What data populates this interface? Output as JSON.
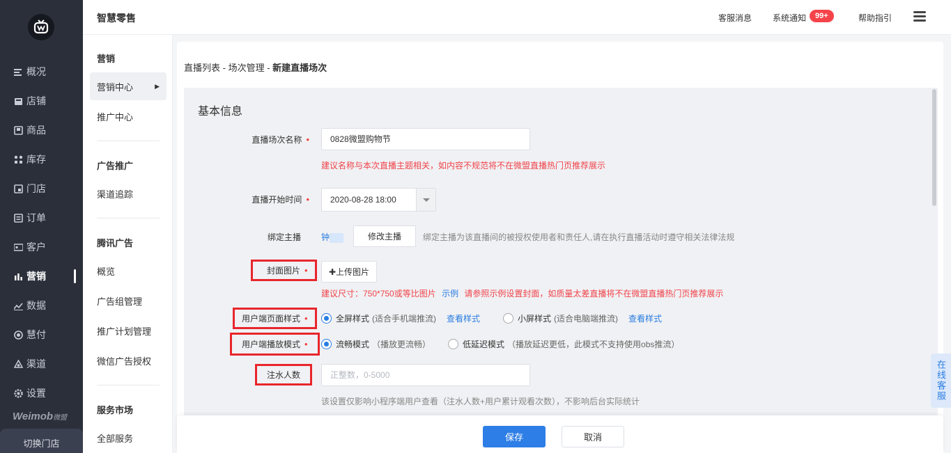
{
  "colors": {
    "sidebar_bg": "#2b2f3a",
    "primary": "#2d7ee6",
    "danger": "#f0434a",
    "highlight_border": "#e8262c"
  },
  "sidebar": {
    "items": [
      {
        "label": "概况",
        "icon": "overview-icon"
      },
      {
        "label": "店铺",
        "icon": "shop-icon"
      },
      {
        "label": "商品",
        "icon": "goods-icon"
      },
      {
        "label": "库存",
        "icon": "inventory-icon"
      },
      {
        "label": "门店",
        "icon": "store-icon"
      },
      {
        "label": "订单",
        "icon": "order-icon"
      },
      {
        "label": "客户",
        "icon": "customer-icon"
      },
      {
        "label": "营销",
        "icon": "marketing-icon",
        "active": true
      },
      {
        "label": "数据",
        "icon": "data-icon"
      },
      {
        "label": "慧付",
        "icon": "pay-icon"
      },
      {
        "label": "渠道",
        "icon": "channel-icon"
      },
      {
        "label": "设置",
        "icon": "settings-icon"
      }
    ],
    "brand": "Weimob",
    "brand_sub": "微盟",
    "switch_store": "切换门店"
  },
  "sub_sidebar": {
    "group1_title": "营销",
    "marketing_center": "营销中心",
    "promotion_center": "推广中心",
    "group2_title": "广告推广",
    "channel_tracking": "渠道追踪",
    "group3_title": "腾讯广告",
    "overview": "概览",
    "ad_group_mgmt": "广告组管理",
    "promo_plan_mgmt": "推广计划管理",
    "wechat_ad_auth": "微信广告授权",
    "group4_title": "服务市场",
    "all_services": "全部服务"
  },
  "header": {
    "title": "智慧零售",
    "customer_msg": "客服消息",
    "system_notice": "系统通知",
    "notice_badge": "99+",
    "help": "帮助指引"
  },
  "breadcrumb": {
    "part1": "直播列表",
    "sep": " - ",
    "part2": "场次管理",
    "current": "新建直播场次"
  },
  "form": {
    "section_title": "基本信息",
    "name_label": "直播场次名称",
    "name_value": "0828微盟购物节",
    "name_hint": "建议名称与本次直播主题相关，如内容不规范将不在微盟直播热门页推荐展示",
    "start_label": "直播开始时间",
    "start_value": "2020-08-28 18:00",
    "anchor_label": "绑定主播",
    "anchor_name": "钟",
    "anchor_button": "修改主播",
    "anchor_hint": "绑定主播为该直播间的被授权使用者和责任人,请在执行直播活动时遵守相关法律法规",
    "cover_label": "封面图片",
    "cover_button": "✚上传图片",
    "cover_hint_size": "建议尺寸：750*750或等比图片",
    "cover_example": "示例",
    "cover_hint_quality": "请参照示例设置封面，如质量太差直播将不在微盟直播热门页推荐展示",
    "page_style_label": "用户端页面样式",
    "page_style_opt1": "全屏样式",
    "page_style_opt1_sub": "(适合手机端推流)",
    "page_style_opt1_link": "查看样式",
    "page_style_opt2": "小屏样式",
    "page_style_opt2_sub": "(适合电脑端推流)",
    "page_style_opt2_link": "查看样式",
    "play_mode_label": "用户端播放模式",
    "play_mode_opt1": "流畅模式",
    "play_mode_opt1_sub": "（播放更流畅）",
    "play_mode_opt2": "低延迟模式",
    "play_mode_opt2_sub": "（播放延迟更低，此模式不支持使用obs推流）",
    "water_label": "注水人数",
    "water_placeholder": "正整数，0-5000",
    "water_hint": "该设置仅影响小程序端用户查看（注水人数+用户累计观看次数），不影响后台实际统计"
  },
  "footer": {
    "save": "保存",
    "cancel": "取消"
  },
  "online_service": "在线客服"
}
